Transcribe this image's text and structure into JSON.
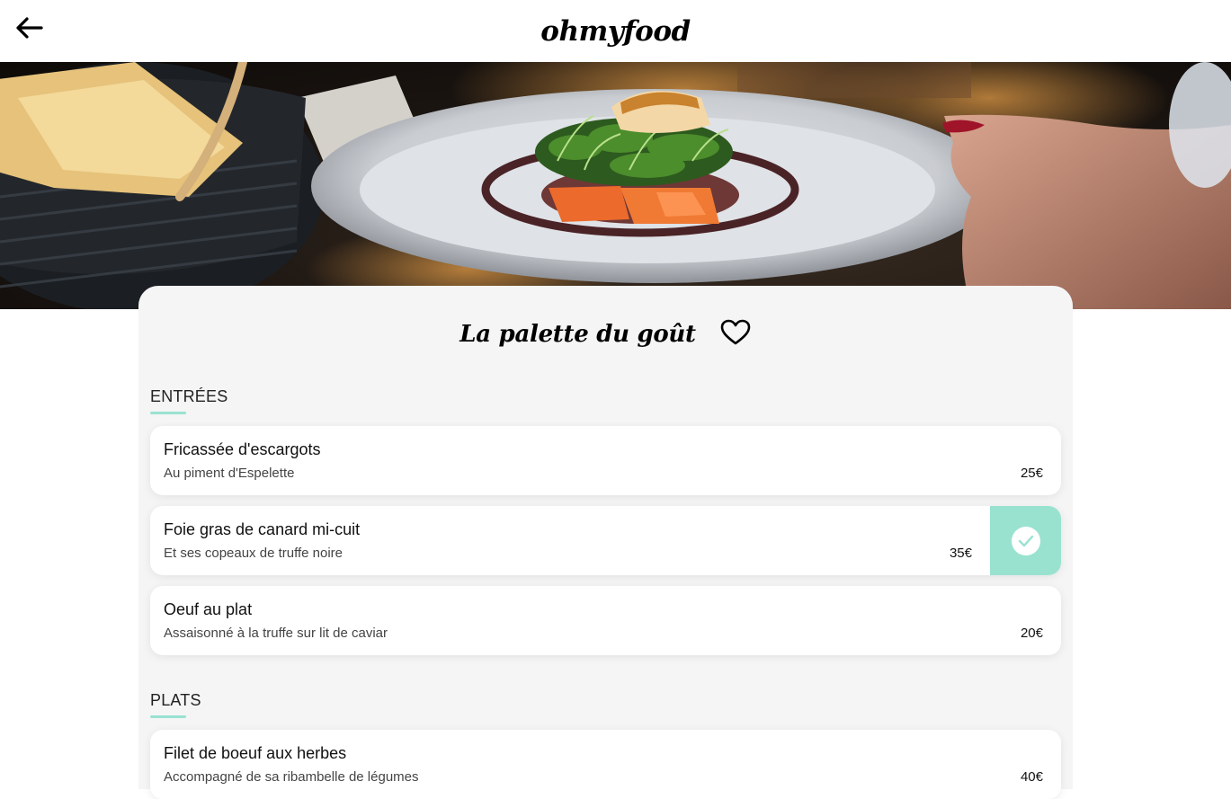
{
  "header": {
    "logo": "ohmyfood",
    "back_icon": "arrow-left-icon"
  },
  "hero": {
    "image_subject": "plated dish with bread basket photo"
  },
  "restaurant": {
    "name": "La palette du goût",
    "favorite_icon": "heart-outline-icon"
  },
  "colors": {
    "accent": "#99e2d0",
    "card_bg": "#f5f5f5"
  },
  "sections": [
    {
      "title": "ENTRÉES",
      "dishes": [
        {
          "name": "Fricassée d'escargots",
          "description": "Au piment d'Espelette",
          "price": "25€",
          "selected": false
        },
        {
          "name": "Foie gras de canard mi-cuit",
          "description": "Et ses copeaux de truffe noire",
          "price": "35€",
          "selected": true
        },
        {
          "name": "Oeuf au plat",
          "description": "Assaisonné à la truffe sur lit de caviar",
          "price": "20€",
          "selected": false
        }
      ]
    },
    {
      "title": "PLATS",
      "dishes": [
        {
          "name": "Filet de boeuf aux herbes",
          "description": "Accompagné de sa ribambelle de légumes",
          "price": "40€",
          "selected": false
        }
      ]
    }
  ]
}
